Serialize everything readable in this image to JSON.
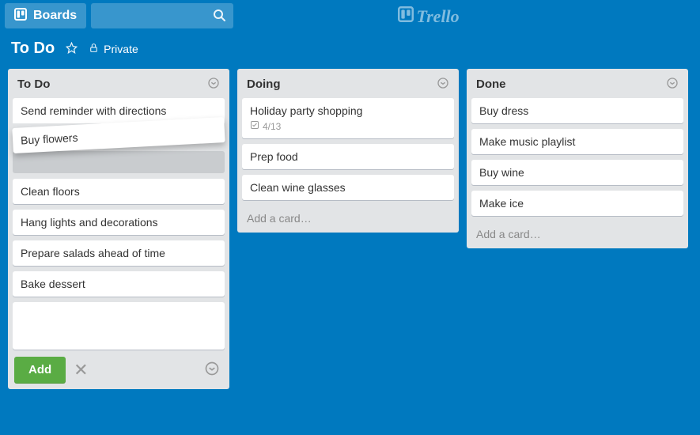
{
  "nav": {
    "boards_label": "Boards",
    "logo_text": "Trello"
  },
  "board": {
    "title": "To Do",
    "visibility": "Private"
  },
  "lists": [
    {
      "title": "To Do",
      "cards": [
        {
          "text": "Send reminder with directions"
        },
        {
          "text": "Buy flowers",
          "dragging": true
        },
        {
          "text": "Clean floors"
        },
        {
          "text": "Hang lights and decorations"
        },
        {
          "text": "Prepare salads ahead of time"
        },
        {
          "text": "Bake dessert"
        }
      ],
      "composer_open": true,
      "add_button_label": "Add"
    },
    {
      "title": "Doing",
      "cards": [
        {
          "text": "Holiday party shopping",
          "checklist": "4/13"
        },
        {
          "text": "Prep food"
        },
        {
          "text": "Clean wine glasses"
        }
      ],
      "add_card_label": "Add a card…"
    },
    {
      "title": "Done",
      "cards": [
        {
          "text": "Buy dress"
        },
        {
          "text": "Make music playlist"
        },
        {
          "text": "Buy wine"
        },
        {
          "text": "Make ice"
        }
      ],
      "add_card_label": "Add a card…"
    }
  ]
}
